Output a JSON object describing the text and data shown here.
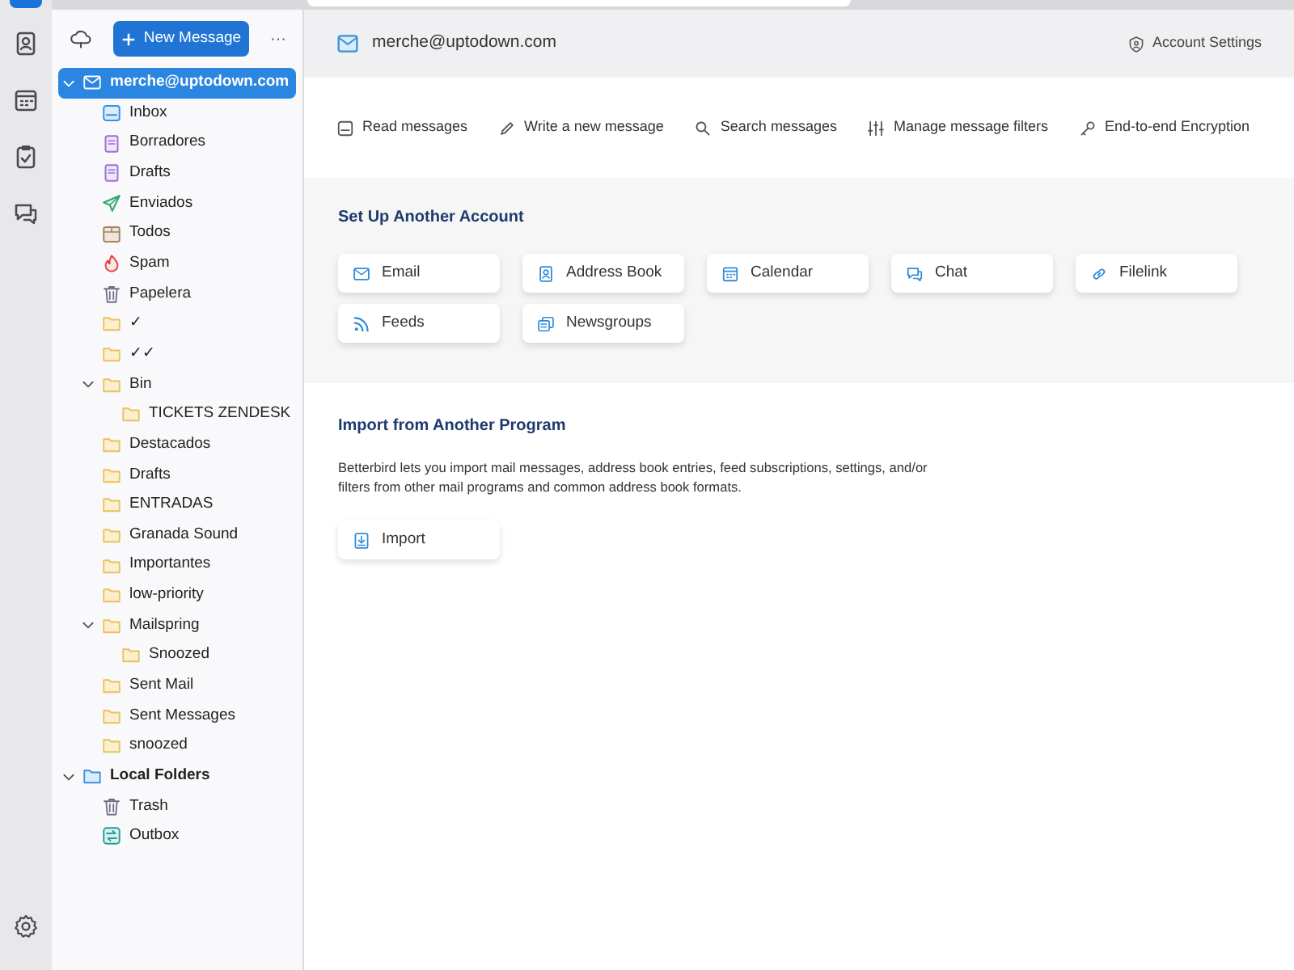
{
  "spaces": [
    {
      "kind": "address",
      "selected": false
    },
    {
      "kind": "calendar",
      "selected": false
    },
    {
      "kind": "tasks",
      "selected": false
    },
    {
      "kind": "chat",
      "selected": false
    }
  ],
  "folder_pane": {
    "new_message": "New Message",
    "more": "···",
    "accounts": [
      {
        "name": "merche@uptodown.com",
        "kind": "mail",
        "selected": true,
        "expanded": true,
        "folders": [
          {
            "name": "Inbox",
            "kind": "inbox"
          },
          {
            "name": "Borradores",
            "kind": "drafts"
          },
          {
            "name": "Drafts",
            "kind": "drafts"
          },
          {
            "name": "Enviados",
            "kind": "sent"
          },
          {
            "name": "Todos",
            "kind": "all"
          },
          {
            "name": "Spam",
            "kind": "spam"
          },
          {
            "name": "Papelera",
            "kind": "trash"
          },
          {
            "name": "✓",
            "kind": "folder"
          },
          {
            "name": "✓✓",
            "kind": "folder"
          },
          {
            "name": "Bin",
            "kind": "folder",
            "expanded": true,
            "children": [
              {
                "name": "TICKETS ZENDESK",
                "kind": "folder"
              }
            ]
          },
          {
            "name": "Destacados",
            "kind": "folder"
          },
          {
            "name": "Drafts",
            "kind": "folder"
          },
          {
            "name": "ENTRADAS",
            "kind": "folder"
          },
          {
            "name": "Granada Sound",
            "kind": "folder"
          },
          {
            "name": "Importantes",
            "kind": "folder"
          },
          {
            "name": "low-priority",
            "kind": "folder"
          },
          {
            "name": "Mailspring",
            "kind": "folder",
            "expanded": true,
            "children": [
              {
                "name": "Snoozed",
                "kind": "folder"
              }
            ]
          },
          {
            "name": "Sent Mail",
            "kind": "folder"
          },
          {
            "name": "Sent Messages",
            "kind": "folder"
          },
          {
            "name": "snoozed",
            "kind": "folder"
          }
        ]
      },
      {
        "name": "Local Folders",
        "kind": "local",
        "selected": false,
        "expanded": true,
        "folders": [
          {
            "name": "Trash",
            "kind": "trash"
          },
          {
            "name": "Outbox",
            "kind": "outbox"
          }
        ]
      }
    ]
  },
  "header": {
    "account": "merche@uptodown.com",
    "account_settings": "Account Settings"
  },
  "actions": [
    {
      "label": "Read messages",
      "kind": "read"
    },
    {
      "label": "Write a new message",
      "kind": "write"
    },
    {
      "label": "Search messages",
      "kind": "search"
    },
    {
      "label": "Manage message filters",
      "kind": "filters"
    },
    {
      "label": "End-to-end Encryption",
      "kind": "key"
    }
  ],
  "setup": {
    "title": "Set Up Another Account",
    "buttons": [
      {
        "label": "Email",
        "kind": "email"
      },
      {
        "label": "Address Book",
        "kind": "address"
      },
      {
        "label": "Calendar",
        "kind": "calendar"
      },
      {
        "label": "Chat",
        "kind": "chat"
      },
      {
        "label": "Filelink",
        "kind": "link"
      },
      {
        "label": "Feeds",
        "kind": "feeds"
      },
      {
        "label": "Newsgroups",
        "kind": "news"
      }
    ]
  },
  "import": {
    "title": "Import from Another Program",
    "description": "Betterbird lets you import mail messages, address book entries, feed subscriptions, settings, and/or filters from other mail programs and common address book formats.",
    "button": "Import"
  }
}
